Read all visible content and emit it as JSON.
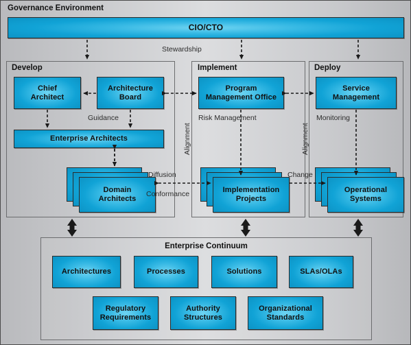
{
  "frame": {
    "title": "Governance Environment"
  },
  "banner": {
    "label": "CIO/CTO"
  },
  "panels": [
    {
      "id": "develop",
      "title": "Develop"
    },
    {
      "id": "implement",
      "title": "Implement"
    },
    {
      "id": "deploy",
      "title": "Deploy"
    }
  ],
  "develop": {
    "chief_architect": "Chief\nArchitect",
    "chief_architect_l1": "Chief",
    "chief_architect_l2": "Architect",
    "architecture_board_l1": "Architecture",
    "architecture_board_l2": "Board",
    "enterprise_architects": "Enterprise Architects",
    "domain_architects_l1": "Domain",
    "domain_architects_l2": "Architects"
  },
  "implement": {
    "pmo_l1": "Program",
    "pmo_l2": "Management Office",
    "projects_l1": "Implementation",
    "projects_l2": "Projects"
  },
  "deploy": {
    "service_management_l1": "Service",
    "service_management_l2": "Management",
    "operational_systems_l1": "Operational",
    "operational_systems_l2": "Systems"
  },
  "connector_labels": {
    "stewardship": "Stewardship",
    "guidance": "Guidance",
    "risk_management": "Risk Management",
    "monitoring": "Monitoring",
    "alignment_left": "Alignment",
    "alignment_right": "Alignment",
    "diffusion": "Diffusion",
    "conformance": "Conformance",
    "change": "Change"
  },
  "continuum": {
    "title": "Enterprise Continuum",
    "row1": [
      {
        "label": "Architectures"
      },
      {
        "label": "Processes"
      },
      {
        "label": "Solutions"
      },
      {
        "label": "SLAs/OLAs"
      }
    ],
    "row2": [
      {
        "l1": "Regulatory",
        "l2": "Requirements"
      },
      {
        "l1": "Authority",
        "l2": "Structures"
      },
      {
        "l1": "Organizational",
        "l2": "Standards"
      }
    ]
  },
  "colors": {
    "box_fill_center": "#6fd4f2",
    "box_fill_edge": "#0d96c8",
    "box_border": "#2b2b2b",
    "background_mid": "#dcdddf",
    "background_edge": "#b9babd",
    "panel_border": "#6b6c6e",
    "text": "#101010",
    "arrow": "#1a1a1a"
  }
}
